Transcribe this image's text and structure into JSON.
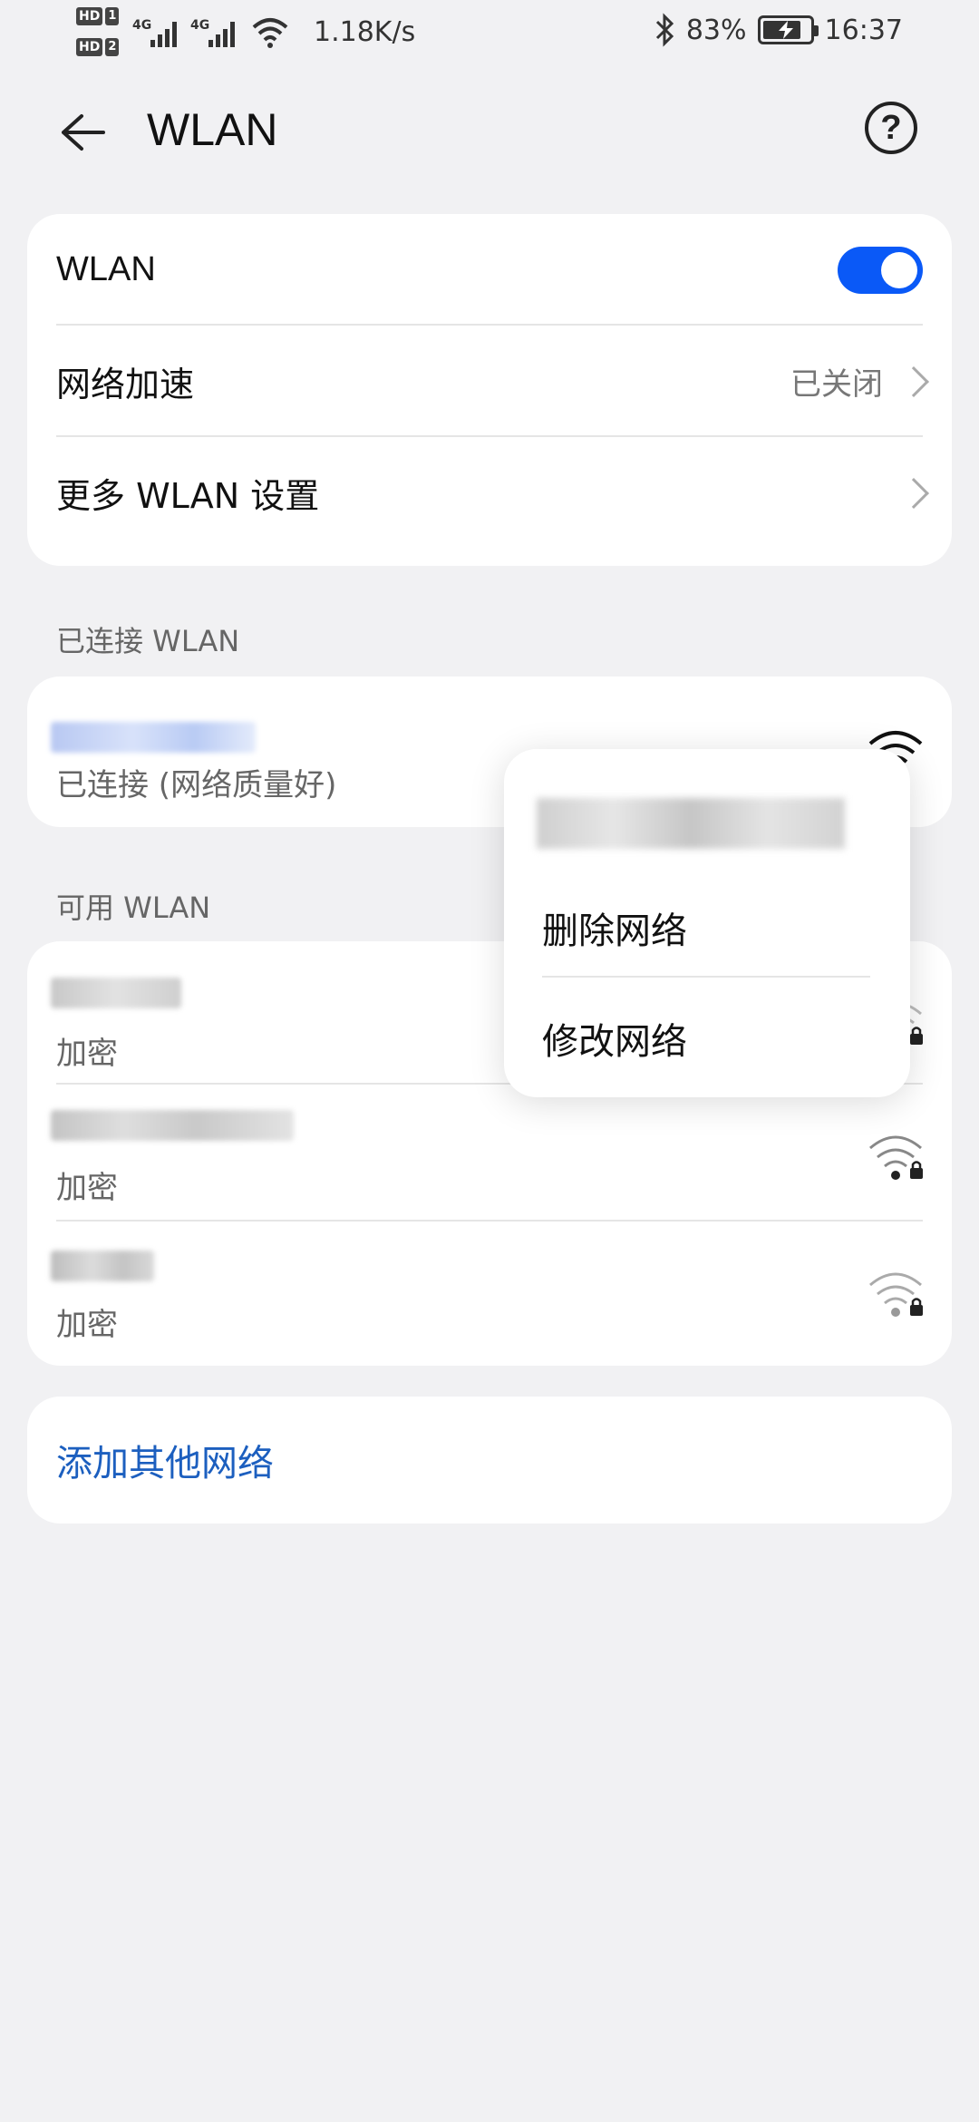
{
  "status_bar": {
    "hd1": "HD",
    "hd1_num": "1",
    "hd2": "HD",
    "hd2_num": "2",
    "net1": "4G",
    "net2": "4G",
    "speed": "1.18K/s",
    "battery": "83%",
    "battery_level": 0.83,
    "time": "16:37",
    "icons": [
      "sim-signal-icon",
      "wifi-status-icon",
      "bluetooth-icon",
      "battery-charging-icon"
    ]
  },
  "header": {
    "title": "WLAN",
    "help_glyph": "?"
  },
  "settings": {
    "wlan_label": "WLAN",
    "wlan_enabled": true,
    "acceleration_label": "网络加速",
    "acceleration_value": "已关闭",
    "more_label": "更多 WLAN 设置"
  },
  "connected": {
    "section_title": "已连接 WLAN",
    "status": "已连接 (网络质量好)"
  },
  "available": {
    "section_title": "可用 WLAN",
    "networks": [
      {
        "security": "加密"
      },
      {
        "security": "加密"
      },
      {
        "security": "加密"
      }
    ]
  },
  "add_network": "添加其他网络",
  "popup": {
    "delete_label": "删除网络",
    "modify_label": "修改网络"
  },
  "colors": {
    "accent": "#0a59f7",
    "link": "#1c5fbf",
    "background": "#f1f1f3"
  }
}
